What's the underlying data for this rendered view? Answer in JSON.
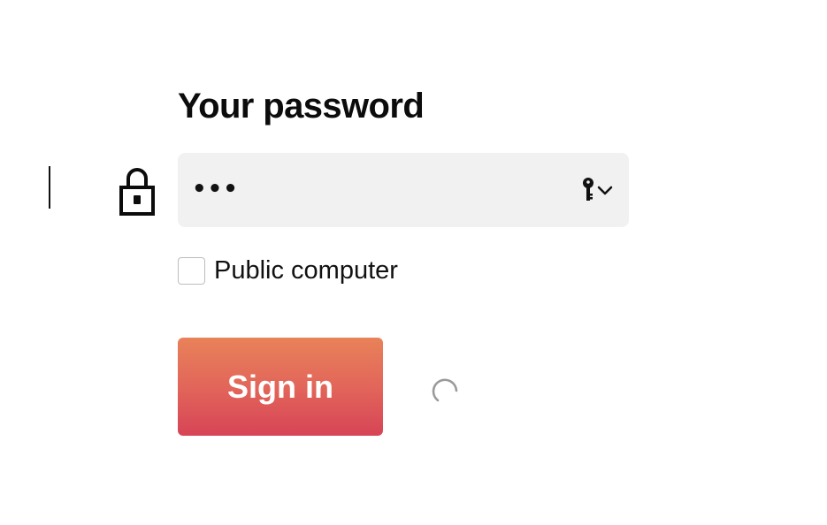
{
  "form": {
    "title": "Your password",
    "password": {
      "masked_value": "•••",
      "focused": true
    },
    "public_computer": {
      "label": "Public computer",
      "checked": false
    },
    "submit": {
      "label": "Sign in",
      "loading": true
    }
  },
  "icons": {
    "lock": "lock-icon",
    "password_manager": "key-icon",
    "dropdown": "chevron-down-icon",
    "loading": "spinner-icon"
  },
  "colors": {
    "button_gradient_top": "#e88259",
    "button_gradient_bottom": "#d74456",
    "field_background": "#f1f1f1",
    "text": "#111111"
  }
}
